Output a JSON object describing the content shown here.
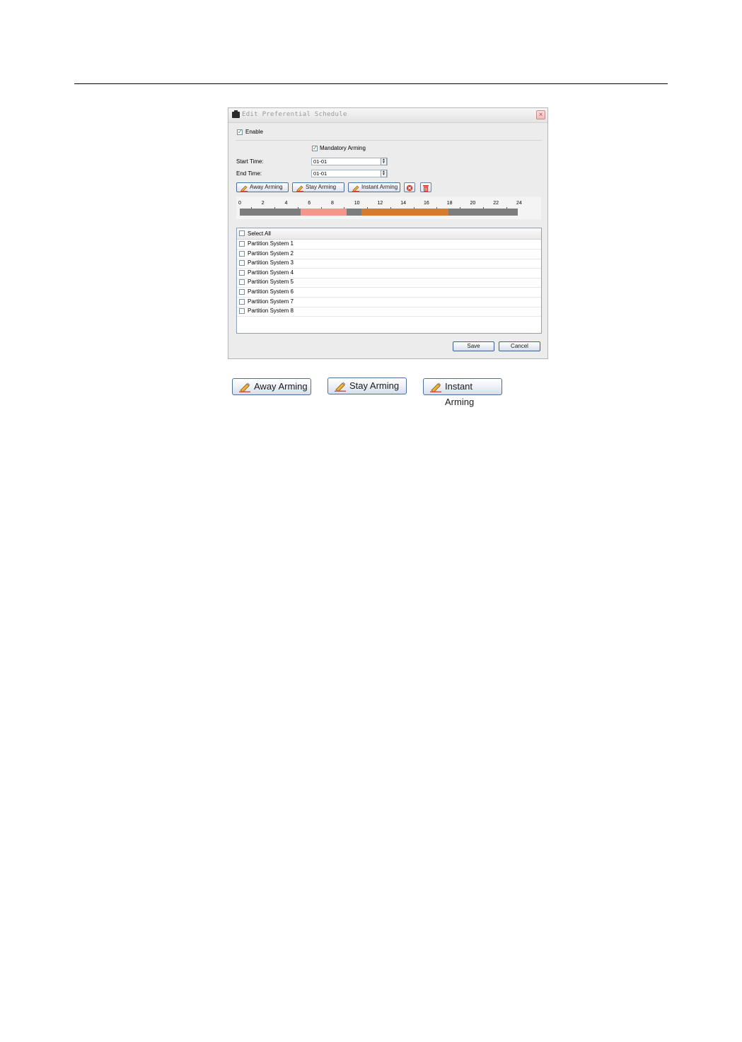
{
  "dialog": {
    "title": "Edit Preferential Schedule",
    "enable_label": "Enable",
    "mandatory_label": "Mandatory Arming",
    "start_time_label": "Start Time:",
    "start_time_value": "01-01",
    "end_time_label": "End Time:",
    "end_time_value": "01-01",
    "toolbar": {
      "away_label": "Away Arming",
      "stay_label": "Stay Arming",
      "instant_label": "Instant Arming"
    },
    "timeline": {
      "ticks": [
        "0",
        "2",
        "4",
        "6",
        "8",
        "10",
        "12",
        "14",
        "16",
        "18",
        "20",
        "22",
        "24"
      ],
      "segments": [
        {
          "mode": "stay",
          "start": 5.25,
          "end": 9.25,
          "color": "#f4978a"
        },
        {
          "mode": "away",
          "start": 10.5,
          "end": 18.0,
          "color": "#d67a2e"
        }
      ],
      "track_color": "#7d7d7d"
    },
    "list": {
      "select_all_label": "Select All",
      "items": [
        "Partition System 1",
        "Partition System 2",
        "Partition System 3",
        "Partition System 4",
        "Partition System 5",
        "Partition System 6",
        "Partition System 7",
        "Partition System 8"
      ]
    },
    "save_label": "Save",
    "cancel_label": "Cancel"
  },
  "legend_buttons": {
    "away_label": "Away Arming",
    "stay_label": "Stay Arming",
    "instant_label": "Instant Arming"
  },
  "icons": {
    "app": "lock-icon",
    "close": "close-icon",
    "pen": "pencil-icon",
    "erase": "erase-icon",
    "delete": "trash-icon"
  }
}
